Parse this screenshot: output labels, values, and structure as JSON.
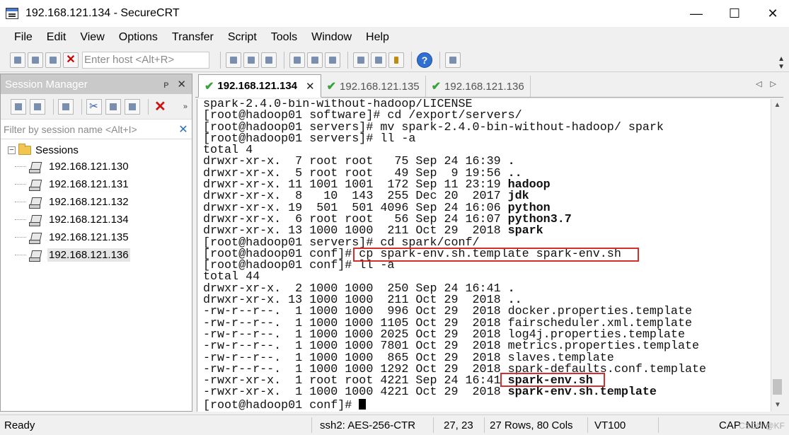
{
  "window": {
    "title": "192.168.121.134 - SecureCRT",
    "minimize": "—",
    "maximize": "☐",
    "close": "✕"
  },
  "menu": [
    "File",
    "Edit",
    "View",
    "Options",
    "Transfer",
    "Script",
    "Tools",
    "Window",
    "Help"
  ],
  "toolbar": {
    "host_placeholder": "Enter host <Alt+R>",
    "help_glyph": "?"
  },
  "session_manager": {
    "title": "Session Manager",
    "pin_glyph": "ᴘ",
    "close_glyph": "✕",
    "filter_placeholder": "Filter by session name <Alt+I>",
    "filter_clear": "✕",
    "root_label": "Sessions",
    "expander": "−",
    "sessions": [
      "192.168.121.130",
      "192.168.121.131",
      "192.168.121.132",
      "192.168.121.134",
      "192.168.121.135",
      "192.168.121.136"
    ],
    "selected_index": 5
  },
  "tabs": [
    {
      "label": "192.168.121.134",
      "active": true,
      "close": "✕"
    },
    {
      "label": "192.168.121.135",
      "active": false
    },
    {
      "label": "192.168.121.136",
      "active": false
    }
  ],
  "tab_nav": "◁▷",
  "terminal": {
    "lines": [
      "spark-2.4.0-bin-without-hadoop/LICENSE",
      "[root@hadoop01 software]# cd /export/servers/",
      "[root@hadoop01 servers]# mv spark-2.4.0-bin-without-hadoop/ spark",
      "[root@hadoop01 servers]# ll -a",
      "total 4",
      [
        "drwxr-xr-x.  7 root root   75 Sep 24 16:39 ",
        "."
      ],
      [
        "drwxr-xr-x.  5 root root   49 Sep  9 19:56 ",
        ".."
      ],
      [
        "drwxr-xr-x. 11 1001 1001  172 Sep 11 23:19 ",
        "hadoop"
      ],
      [
        "drwxr-xr-x.  8   10  143  255 Dec 20  2017 ",
        "jdk"
      ],
      [
        "drwxr-xr-x. 19  501  501 4096 Sep 24 16:06 ",
        "python"
      ],
      [
        "drwxr-xr-x.  6 root root   56 Sep 24 16:07 ",
        "python3.7"
      ],
      [
        "drwxr-xr-x. 13 1000 1000  211 Oct 29  2018 ",
        "spark"
      ],
      "[root@hadoop01 servers]# cd spark/conf/",
      "[root@hadoop01 conf]# cp spark-env.sh.template spark-env.sh",
      "[root@hadoop01 conf]# ll -a",
      "total 44",
      [
        "drwxr-xr-x.  2 1000 1000  250 Sep 24 16:41 ",
        "."
      ],
      [
        "drwxr-xr-x. 13 1000 1000  211 Oct 29  2018 ",
        ".."
      ],
      "-rw-r--r--.  1 1000 1000  996 Oct 29  2018 docker.properties.template",
      "-rw-r--r--.  1 1000 1000 1105 Oct 29  2018 fairscheduler.xml.template",
      "-rw-r--r--.  1 1000 1000 2025 Oct 29  2018 log4j.properties.template",
      "-rw-r--r--.  1 1000 1000 7801 Oct 29  2018 metrics.properties.template",
      "-rw-r--r--.  1 1000 1000  865 Oct 29  2018 slaves.template",
      "-rw-r--r--.  1 1000 1000 1292 Oct 29  2018 spark-defaults.conf.template",
      [
        "-rwxr-xr-x.  1 root root 4221 Sep 24 16:41 ",
        "spark-env.sh"
      ],
      [
        "-rwxr-xr-x.  1 1000 1000 4221 Oct 29  2018 ",
        "spark-env.sh.template"
      ],
      "[root@hadoop01 conf]# "
    ]
  },
  "statusbar": {
    "ready": "Ready",
    "cipher": "ssh2: AES-256-CTR",
    "cursor_pos": "27,  23",
    "size": "27 Rows, 80 Cols",
    "emulation": "VT100",
    "caps": "CAP",
    "num": "NUM",
    "watermark": "CSDN @KF"
  },
  "colors": {
    "highlight_box": "#d32f2f",
    "tab_check": "#3aa23a",
    "panel_header": "#c9c9c9"
  }
}
